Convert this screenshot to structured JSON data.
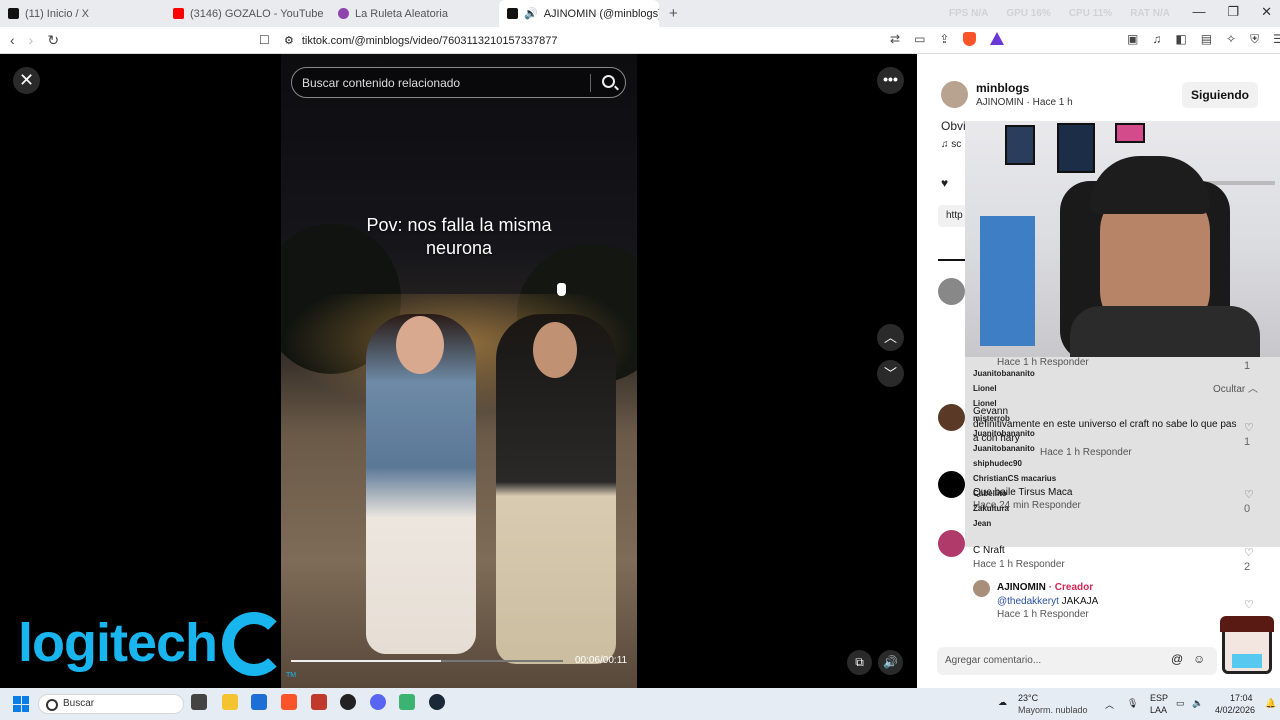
{
  "browser": {
    "tabs": [
      {
        "title": "(11) Inicio / X",
        "favicon_color": "#111111"
      },
      {
        "title": "(3146) GOZALO - YouTube",
        "favicon_color": "#ff0000"
      },
      {
        "title": "La Ruleta Aleatoria",
        "favicon_color": "#8e44ad"
      },
      {
        "title": "AJINOMIN (@minblogs) | Tik",
        "favicon_color": "#111111",
        "active": true
      }
    ],
    "metrics": [
      "FPS N/A",
      "GPU 16%",
      "CPU 11%",
      "RAT N/A"
    ],
    "url": "tiktok.com/@minblogs/video/7603113210157337877"
  },
  "video": {
    "search_placeholder": "Buscar contenido relacionado",
    "caption_line1": "Pov: nos falla la misma",
    "caption_line2": "neurona",
    "time": "00:06/00:11",
    "progress_fraction": 0.55,
    "logo_text": "logitech",
    "logo_tm": "TM"
  },
  "author": {
    "username": "minblogs",
    "subtitle": "AJINOMIN · Hace 1 h",
    "follow_label": "Siguiendo",
    "desc_partial": "Obvi",
    "music_partial": "sc",
    "link_partial": "http"
  },
  "chat": [
    {
      "text": "Hace 1 h    Responder",
      "color": "#555555"
    },
    {
      "text": "Juanitobananito",
      "color": "#c9a227"
    },
    {
      "text": "Lionel",
      "color": "#d22d62"
    },
    {
      "text": "Lionel",
      "color": "#d22d62"
    },
    {
      "text": "misterrob",
      "color": "#b23c2a"
    },
    {
      "text": "Juanitobananito",
      "color": "#c9a227"
    },
    {
      "text": "Juanitobananito",
      "color": "#c9a227"
    },
    {
      "text": "shiphudec90",
      "color": "#d48a1f"
    },
    {
      "text": "ChristianCS  macarius",
      "color": "#2a2a90"
    },
    {
      "text": "Cabellito",
      "color": "#2e9b55"
    },
    {
      "text": "Zakultura",
      "color": "#2e9b55"
    },
    {
      "text": "Jean ",
      "color": "#6b3fd6"
    }
  ],
  "comments": {
    "hide_label": "Ocultar",
    "items": [
      {
        "user": "Gevann",
        "text_line1": "definitivamente en este universo el craft no sabe lo que pas",
        "text_line2": "a con hary",
        "meta": "Hace 1 h   Responder",
        "likes": "1"
      },
      {
        "user": "",
        "text_line1": "Que baile Tirsus Maca",
        "text_line2": "",
        "meta": "Hace 24 min   Responder",
        "likes": "0"
      },
      {
        "user": "C Nraft",
        "text_line1": "",
        "text_line2": "",
        "meta": "Hace 1 h   Responder",
        "likes": "2"
      }
    ],
    "reply_user": "AJINOMIN",
    "reply_badge": "· Creador",
    "reply_mention": "@thedakkeryt",
    "reply_text": "JAKAJA",
    "reply_meta": "Hace 1 h   Responder",
    "reply_likes": "0",
    "top_meta": "Hace 1 h   Responder",
    "top_likes": "1",
    "add_placeholder": "Agregar comentario..."
  },
  "taskbar": {
    "search_label": "Buscar",
    "weather_temp": "23°C",
    "weather_desc": "Mayorm. nublado",
    "lang_line1": "ESP",
    "lang_line2": "LAA",
    "time": "17:04",
    "date": "4/02/2026"
  }
}
